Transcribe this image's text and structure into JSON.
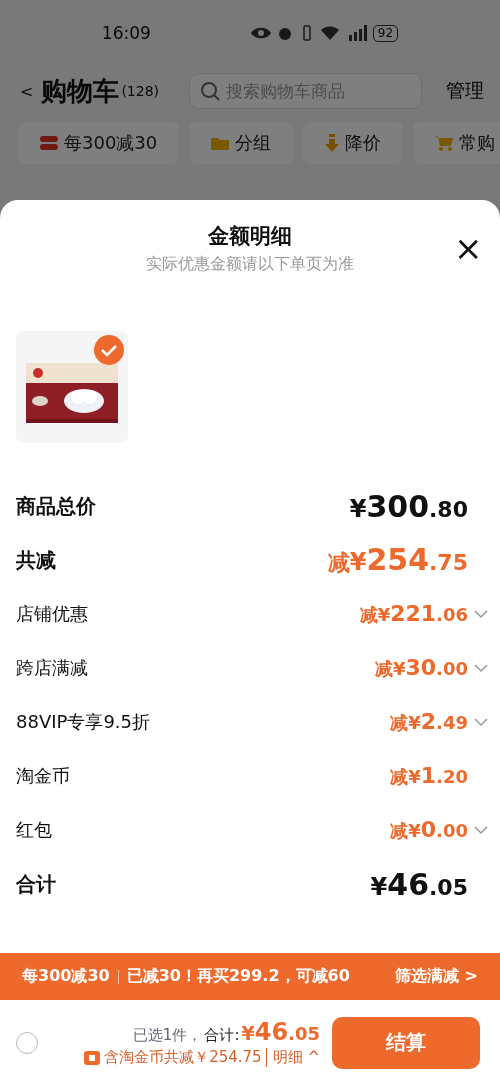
{
  "status_bar": {
    "time": "16:09",
    "battery": "92"
  },
  "header": {
    "back": "<",
    "title": "购物车",
    "count": "(128)",
    "search_placeholder": "搜索购物车商品",
    "manage": "管理"
  },
  "chips": [
    {
      "kind": "coupon",
      "label": "每300减30"
    },
    {
      "kind": "folder",
      "label": "分组"
    },
    {
      "kind": "down",
      "label": "降价"
    },
    {
      "kind": "cart",
      "label": "常购"
    }
  ],
  "sheet": {
    "title": "金额明细",
    "subtitle": "实际优惠金额请以下单页为准",
    "close": "×",
    "products": [
      {
        "kind": "picture",
        "checked": true
      }
    ],
    "rows": [
      {
        "kind": "total",
        "label": "商品总价",
        "prefix": "",
        "amount": "¥300.80",
        "dropdown": false
      },
      {
        "kind": "reduction",
        "label": "共减",
        "prefix": "减",
        "amount": "¥254.75",
        "dropdown": false
      },
      {
        "kind": "item",
        "label": "店铺优惠",
        "prefix": "减",
        "amount": "¥221.06",
        "dropdown": true
      },
      {
        "kind": "item",
        "label": "跨店满减",
        "prefix": "减",
        "amount": "¥30.00",
        "dropdown": true
      },
      {
        "kind": "item",
        "label": "88VIP专享9.5折",
        "prefix": "减",
        "amount": "¥2.49",
        "dropdown": true
      },
      {
        "kind": "item",
        "label": "淘金币",
        "prefix": "减",
        "amount": "¥1.20",
        "dropdown": false
      },
      {
        "kind": "item",
        "label": "红包",
        "prefix": "减",
        "amount": "¥0.00",
        "dropdown": true
      },
      {
        "kind": "total",
        "label": "合计",
        "prefix": "",
        "amount": "¥46.05",
        "dropdown": false
      }
    ]
  },
  "promo_bar": {
    "rule": "每300减30",
    "message": "已减30！再买299.2，可减60",
    "action": "筛选满减 >"
  },
  "checkout": {
    "select_all_checked": false,
    "selected": "已选1件，",
    "total_label": "合计:",
    "total": "¥46.05",
    "savings": "含淘金币共减￥254.75",
    "detail": "明细 ^",
    "button": "结算"
  }
}
